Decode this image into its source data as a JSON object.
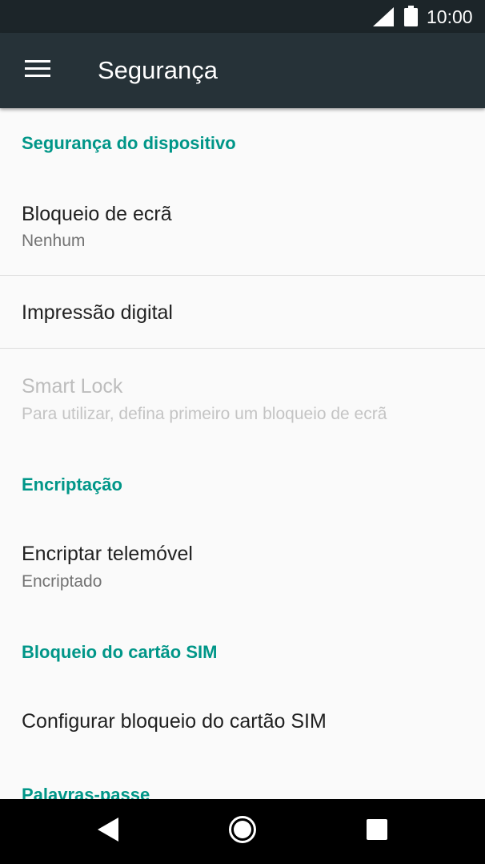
{
  "status_bar": {
    "time": "10:00"
  },
  "toolbar": {
    "title": "Segurança"
  },
  "sections": {
    "device_security": {
      "header": "Segurança do dispositivo",
      "screen_lock": {
        "title": "Bloqueio de ecrã",
        "summary": "Nenhum"
      },
      "fingerprint": {
        "title": "Impressão digital"
      },
      "smart_lock": {
        "title": "Smart Lock",
        "summary": "Para utilizar, defina primeiro um bloqueio de ecrã"
      }
    },
    "encryption": {
      "header": "Encriptação",
      "encrypt_phone": {
        "title": "Encriptar telemóvel",
        "summary": "Encriptado"
      }
    },
    "sim_lock": {
      "header": "Bloqueio do cartão SIM",
      "configure": {
        "title": "Configurar bloqueio do cartão SIM"
      }
    },
    "passwords": {
      "header": "Palavras-passe"
    }
  },
  "colors": {
    "toolbar": "#263238",
    "status_bar": "#1c2529",
    "accent": "#009688",
    "background": "#fafafa"
  },
  "icons": {
    "menu": "hamburger-menu-icon",
    "signal": "signal-icon",
    "battery": "battery-icon",
    "back": "back-triangle-icon",
    "home": "home-circle-icon",
    "recents": "recents-square-icon"
  }
}
